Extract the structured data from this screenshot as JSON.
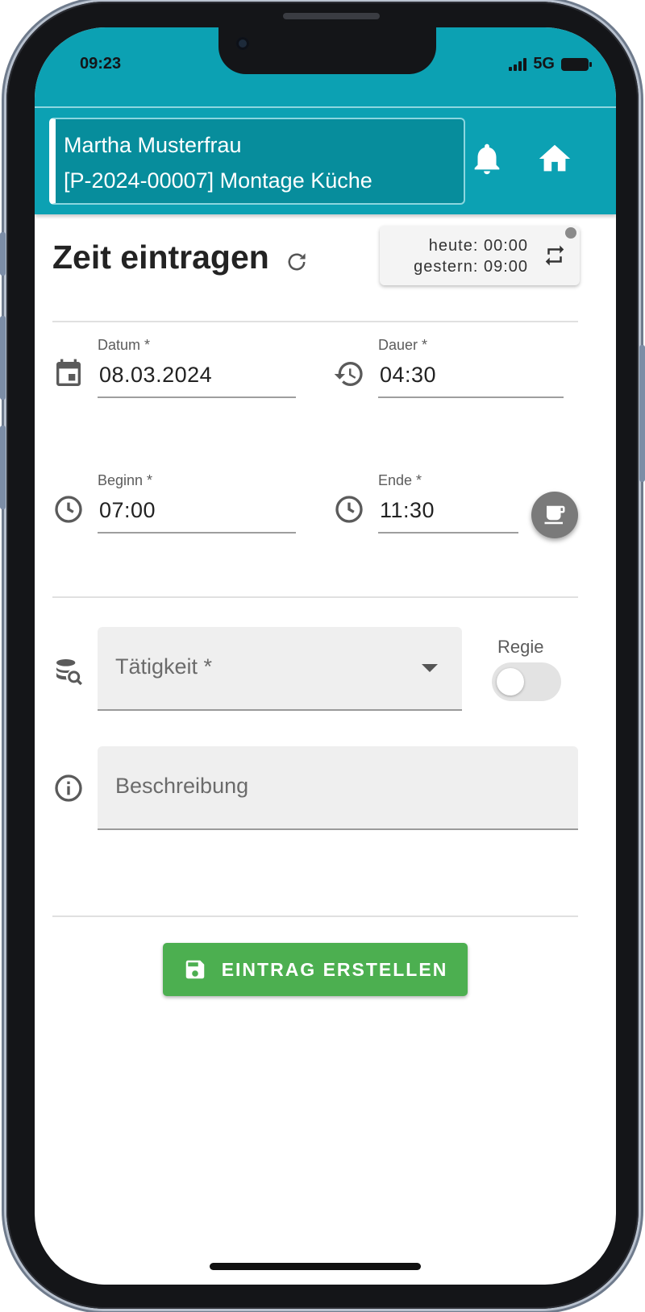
{
  "status_bar": {
    "time": "09:23",
    "network": "5G"
  },
  "app_bar": {
    "user_name": "Martha Musterfrau",
    "project": "[P-2024-00007] Montage Küche",
    "icons": [
      "bell-icon",
      "home-icon"
    ]
  },
  "header": {
    "title": "Zeit eintragen",
    "summary_today": "heute: 00:00",
    "summary_yesterday": "gestern: 09:00"
  },
  "form": {
    "date": {
      "label": "Datum *",
      "value": "08.03.2024",
      "icon": "calendar-icon"
    },
    "duration": {
      "label": "Dauer *",
      "value": "04:30",
      "icon": "history-icon"
    },
    "start": {
      "label": "Beginn *",
      "value": "07:00",
      "icon": "clock-icon"
    },
    "end": {
      "label": "Ende *",
      "value": "11:30",
      "icon": "clock-icon"
    },
    "activity": {
      "placeholder": "Tätigkeit *",
      "icon": "database-search-icon"
    },
    "regie": {
      "label": "Regie",
      "checked": false
    },
    "description": {
      "placeholder": "Beschreibung",
      "icon": "info-icon"
    }
  },
  "actions": {
    "submit_label": "EINTRAG ERSTELLEN"
  },
  "colors": {
    "primary": "#0ca1b3",
    "primary_dark": "#078d9c",
    "success": "#4caf50"
  }
}
